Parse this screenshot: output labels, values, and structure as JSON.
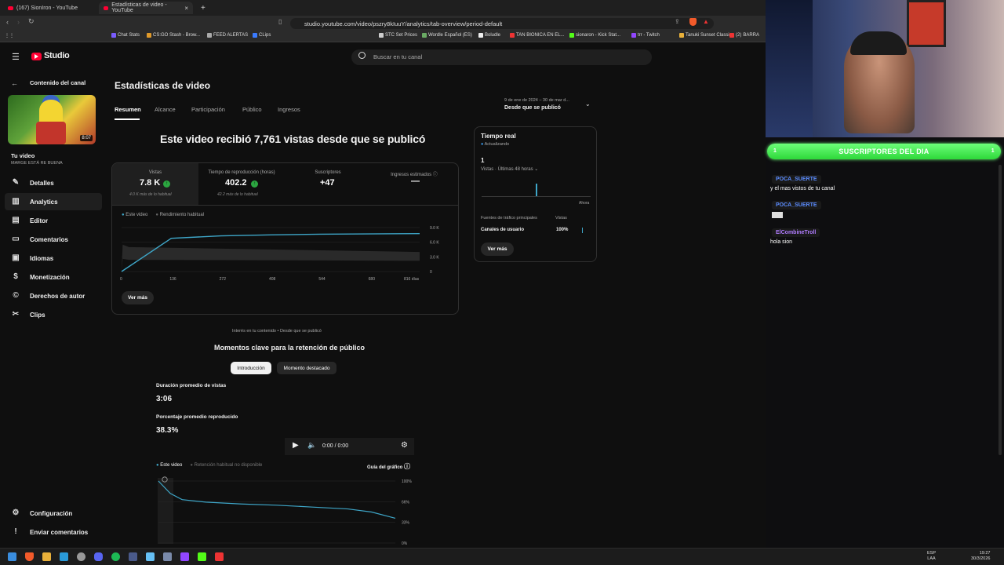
{
  "browser": {
    "tabs": [
      {
        "label": "(167) SionIron - YouTube"
      },
      {
        "label": "Estadísticas de video - YouTube"
      }
    ],
    "url": "studio.youtube.com/video/pszry8kIuuY/analytics/tab-overview/period-default",
    "bookmarks": [
      "Chat Stats",
      "CS:GO Stash - Brow...",
      "FEED ALERTAS",
      "CLips",
      "STC Set Prices",
      "Wordle Español (ES)",
      "Boludle",
      "TAN BIONICA EN EL...",
      "sionaron - Kick Stat...",
      "trr - Twitch",
      "Tanuki Sunset Classi...",
      "(2)",
      "BARRA"
    ]
  },
  "header": {
    "logo": "Studio",
    "search_placeholder": "Buscar en tu canal"
  },
  "sidebar": {
    "back_label": "Contenido del canal",
    "video_duration": "8:07",
    "your_video": "Tu video",
    "video_title": "MARGE ESTÁ RE BUENA",
    "items": [
      {
        "label": "Detalles",
        "icon": "pencil-icon"
      },
      {
        "label": "Analytics",
        "icon": "analytics-icon"
      },
      {
        "label": "Editor",
        "icon": "editor-icon"
      },
      {
        "label": "Comentarios",
        "icon": "comment-icon"
      },
      {
        "label": "Idiomas",
        "icon": "subtitles-icon"
      },
      {
        "label": "Monetización",
        "icon": "dollar-icon"
      },
      {
        "label": "Derechos de autor",
        "icon": "copyright-icon"
      },
      {
        "label": "Clips",
        "icon": "scissors-icon"
      }
    ],
    "bottom": [
      {
        "label": "Configuración",
        "icon": "gear-icon"
      },
      {
        "label": "Enviar comentarios",
        "icon": "feedback-icon"
      }
    ]
  },
  "main": {
    "title": "Estadísticas de video",
    "tabs": [
      "Resumen",
      "Alcance",
      "Participación",
      "Público",
      "Ingresos"
    ],
    "period_range": "9 de ene de 2024 – 30 de mar d...",
    "period_label": "Desde que se publicó",
    "headline": "Este video recibió 7,761 vistas desde que se publicó",
    "metrics": [
      {
        "label": "Vistas",
        "value": "7.8 K",
        "sub": "4.0 K más de lo habitual"
      },
      {
        "label": "Tiempo de reproducción (horas)",
        "value": "402.2",
        "sub": "42.2 más de lo habitual"
      },
      {
        "label": "Suscriptores",
        "value": "+47",
        "sub": ""
      },
      {
        "label": "Ingresos estimados",
        "value": "—",
        "sub": ""
      }
    ],
    "legend": [
      "Este video",
      "Rendimiento habitual"
    ],
    "see_more": "Ver más",
    "interest_note": "Interés en tu contenido • Desde que se publicó",
    "retention_title": "Momentos clave para la retención de público",
    "chips": [
      "Introducción",
      "Momento destacado"
    ],
    "avg_duration_label": "Duración promedio de vistas",
    "avg_duration": "3:06",
    "avg_pct_label": "Porcentaje promedio reproducido",
    "avg_pct": "38.3%",
    "player_time": "0:00 / 0:00",
    "retention_legend": [
      "Este video",
      "Retención habitual no disponible"
    ],
    "chart_guide": "Guía del gráfico"
  },
  "realtime": {
    "title": "Tiempo real",
    "status": "Actualizando",
    "count": "1",
    "views_label": "Vistas · Últimas 48 horas",
    "now_label": "Ahora",
    "traffic_header": "Fuentes de tráfico principales",
    "views_col": "Vistas",
    "source": "Canales de usuario",
    "source_pct": "100%",
    "see_more": "Ver más"
  },
  "chart_data": [
    {
      "type": "line",
      "series": [
        {
          "name": "Este video",
          "values": [
            0,
            6800,
            7300,
            7500,
            7650,
            7761
          ]
        }
      ],
      "x": [
        0,
        136,
        272,
        408,
        544,
        816
      ],
      "x_ticks": [
        "0",
        "136",
        "272",
        "408",
        "544",
        "680",
        "816 días"
      ],
      "y_ticks": [
        "0",
        "3.0 K",
        "6.0 K",
        "9.0 K"
      ],
      "ylim": [
        0,
        9000
      ]
    },
    {
      "type": "line",
      "series": [
        {
          "name": "Este video",
          "values": [
            100,
            80,
            70,
            66,
            63,
            61,
            58,
            55,
            50,
            40
          ]
        }
      ],
      "x": [
        0,
        5,
        10,
        20,
        35,
        50,
        65,
        80,
        90,
        100
      ],
      "y_ticks": [
        "0%",
        "33%",
        "66%",
        "100%"
      ],
      "ylim": [
        0,
        100
      ]
    }
  ],
  "chat": {
    "banner": "SUSCRIPTORES DEL DIA",
    "banner_count": "1",
    "messages": [
      {
        "user": "POCA_SUERTE",
        "text": "y el mas vistos de tu canal",
        "color": "#5b8cff"
      },
      {
        "user": "POCA_SUERTE",
        "text": "",
        "color": "#5b8cff"
      },
      {
        "user": "ElCombineTroll",
        "text": "hola sion",
        "color": "#b07cff"
      }
    ]
  },
  "taskbar": {
    "lang": "ESP",
    "region": "LAA",
    "time": "19:27",
    "date": "30/3/2026"
  }
}
